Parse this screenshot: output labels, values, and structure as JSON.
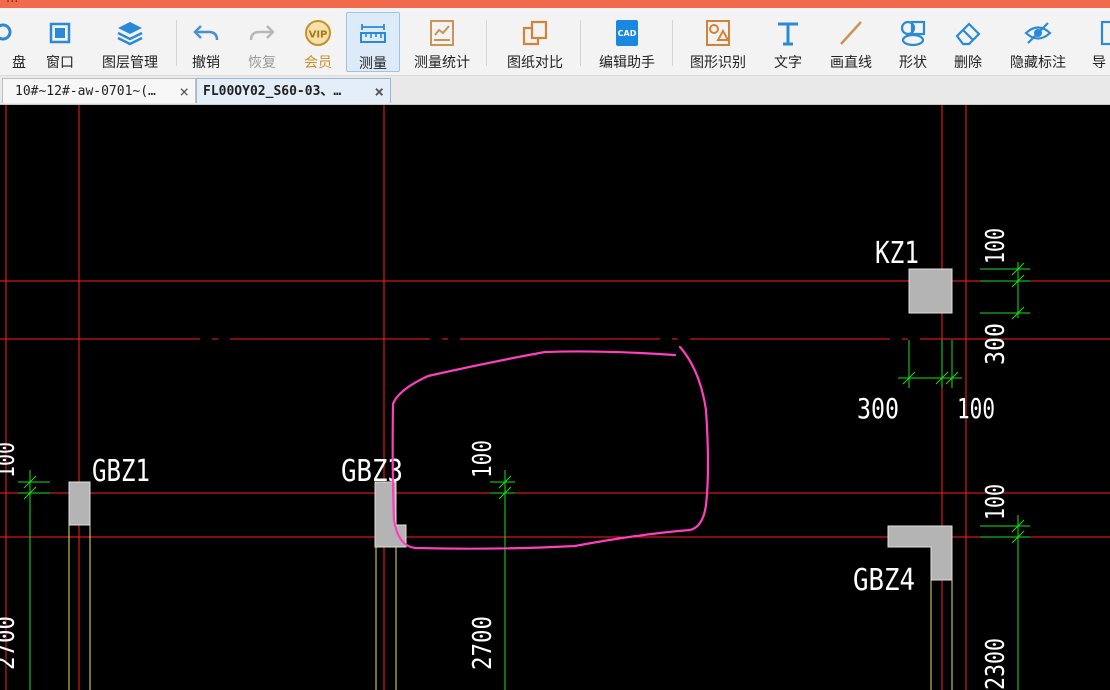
{
  "window": {
    "title_fragment": "..."
  },
  "toolbar": {
    "items": [
      {
        "id": "tb-disk",
        "label": "盘",
        "icon": "disk-icon"
      },
      {
        "id": "tb-window",
        "label": "窗口",
        "icon": "window-icon"
      },
      {
        "id": "tb-layers",
        "label": "图层管理",
        "icon": "layers-icon"
      },
      {
        "id": "tb-undo",
        "label": "撤销",
        "icon": "undo-icon"
      },
      {
        "id": "tb-redo",
        "label": "恢复",
        "icon": "redo-icon"
      },
      {
        "id": "tb-vip",
        "label": "会员",
        "icon": "vip-icon",
        "badge": "VIP"
      },
      {
        "id": "tb-measure",
        "label": "测量",
        "icon": "ruler-icon"
      },
      {
        "id": "tb-measure-stats",
        "label": "测量统计",
        "icon": "measure-chart-icon"
      },
      {
        "id": "tb-compare",
        "label": "图纸对比",
        "icon": "compare-icon"
      },
      {
        "id": "tb-edit-helper",
        "label": "编辑助手",
        "icon": "cad-edit-icon",
        "badge": "CAD"
      },
      {
        "id": "tb-shape-recog",
        "label": "图形识别",
        "icon": "shape-recognition-icon"
      },
      {
        "id": "tb-text",
        "label": "文字",
        "icon": "text-icon"
      },
      {
        "id": "tb-line",
        "label": "画直线",
        "icon": "line-icon"
      },
      {
        "id": "tb-shape",
        "label": "形状",
        "icon": "shape-icon"
      },
      {
        "id": "tb-delete",
        "label": "删除",
        "icon": "eraser-icon"
      },
      {
        "id": "tb-hide",
        "label": "隐藏标注",
        "icon": "hide-eye-icon"
      },
      {
        "id": "tb-export",
        "label": "导",
        "icon": "export-icon"
      }
    ]
  },
  "tabs": [
    {
      "title": "10#~12#-aw-0701~(…",
      "close": "×",
      "active": false
    },
    {
      "title": "FL00OY02_S60-03、…",
      "close": "×",
      "active": true
    }
  ],
  "drawing": {
    "labels": {
      "kz1": "KZ1",
      "gbz1": "GBZ1",
      "gbz3": "GBZ3",
      "gbz4": "GBZ4",
      "dim_top": "100",
      "dim_300v": "300",
      "dim_300h": "300",
      "dim_100h": "100",
      "dim_100_mid": "100",
      "dim_100_left": "100",
      "dim_100_right": "100",
      "dim_2700_mid": "2700",
      "dim_2700_left": "2700",
      "dim_2300": "2300"
    },
    "colors": {
      "background": "#000000",
      "axis": "#ff2020",
      "dim": "#18e018",
      "column_fill": "#b4b4b4",
      "wall_line": "#e8e84a",
      "annotation": "#ff3fbf",
      "text": "#ffffff"
    }
  }
}
